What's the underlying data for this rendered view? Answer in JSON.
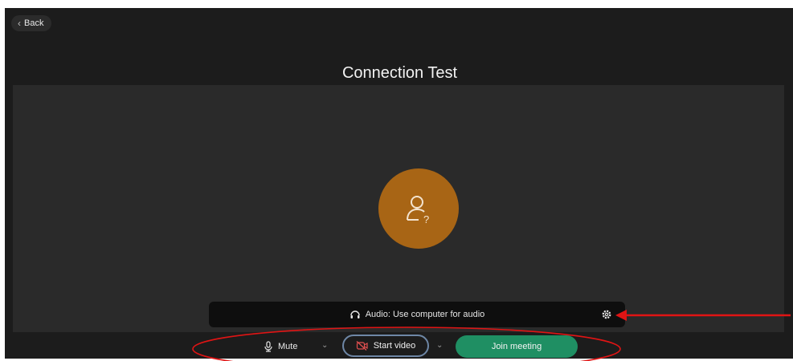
{
  "header": {
    "back_label": "Back"
  },
  "page": {
    "title": "Connection Test"
  },
  "preview": {
    "avatar_icon": "user-unknown-icon",
    "avatar_color": "#a86515"
  },
  "audio": {
    "label": "Audio: Use computer for audio",
    "icon": "headset-icon",
    "settings_icon": "gear-icon"
  },
  "controls": {
    "mute_label": "Mute",
    "start_video_label": "Start video",
    "join_label": "Join meeting",
    "join_color": "#1f8f63"
  },
  "annotations": {
    "highlight_color": "#e01414"
  }
}
